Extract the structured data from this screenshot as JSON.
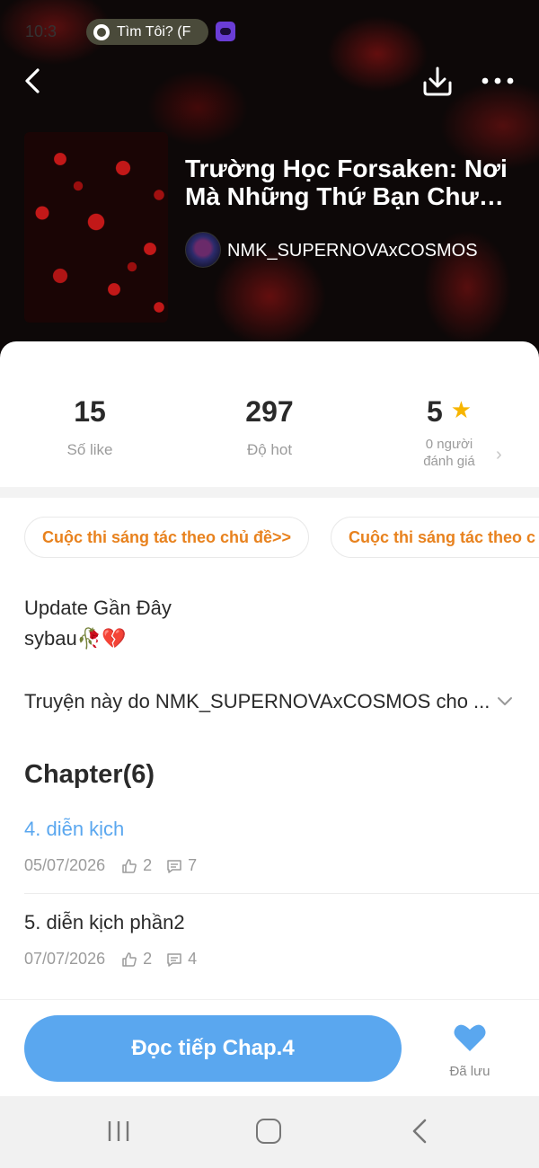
{
  "status_bar": {
    "time": "10:3",
    "pill_label": "Tìm Tôi? (F"
  },
  "header": {
    "title": "Trường Học Forsaken: Nơi Mà Những Thứ Bạn Chưa Biết",
    "author": "NMK_SUPERNOVAxCOSMOS"
  },
  "stats": {
    "likes": {
      "value": "15",
      "label": "Số like"
    },
    "hot": {
      "value": "297",
      "label": "Độ hot"
    },
    "rating": {
      "value": "5",
      "label_line1": "0 người",
      "label_line2": "đánh giá"
    }
  },
  "contests": [
    {
      "label": "Cuộc thi sáng tác theo chủ đề>>"
    },
    {
      "label": "Cuộc thi sáng tác theo c"
    }
  ],
  "update": {
    "title": "Update Gần Đây",
    "text": "sybau",
    "emoji": "🥀💔"
  },
  "description": "Truyện này do NMK_SUPERNOVAxCOSMOS cho ...",
  "chapters": {
    "heading": "Chapter(6)",
    "items": [
      {
        "title": "4. diễn kịch",
        "date": "05/07/2026",
        "likes": "2",
        "comments": "7",
        "active": true
      },
      {
        "title": "5. diễn kịch phần2",
        "date": "07/07/2026",
        "likes": "2",
        "comments": "4",
        "active": false
      }
    ]
  },
  "actions": {
    "read_button": "Đọc tiếp Chap.4",
    "save_label": "Đã lưu"
  },
  "colors": {
    "accent_blue": "#5aa7ef",
    "contest_orange": "#e8821e",
    "star": "#f7b500"
  }
}
